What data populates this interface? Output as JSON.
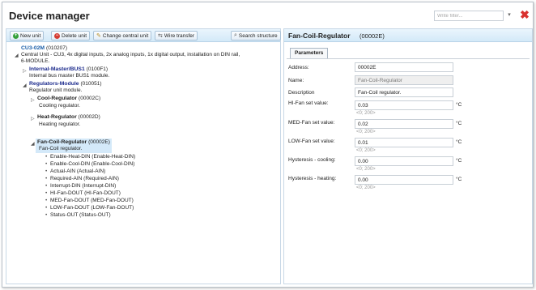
{
  "app": {
    "title": "Device manager",
    "filter_placeholder": "Write filter...",
    "close_label": "✖"
  },
  "toolbar": {
    "new_unit": "New unit",
    "delete_unit": "Delete unit",
    "change_central_unit": "Change central unit",
    "wire_transfer": "Wire transfer",
    "search_structure": "Search structure"
  },
  "tree": {
    "root": {
      "title": "CU3-02M",
      "code": "(010207)",
      "desc1": "Central Unit - CU3, 4x digital inputs, 2x analog inputs, 1x digital output, installation on DIN rail,",
      "desc2": "6-MODULE."
    },
    "internal_master": {
      "title": "Internal-Master/BUS1",
      "code": "(0100F1)",
      "desc": "Internal bus master BUS1 module."
    },
    "regulators": {
      "title": "Regulators-Module",
      "code": "(010051)",
      "desc": "Regulator unit module."
    },
    "cool": {
      "title": "Cool-Regulator",
      "code": "(00002C)",
      "desc": "Cooling regulator."
    },
    "heat": {
      "title": "Heat-Regulator",
      "code": "(00002D)",
      "desc": "Heating regulator."
    },
    "fancoil": {
      "title": "Fan-Coil-Regulator",
      "code": "(00002E)",
      "desc": "Fan-Coil regulator.",
      "children": [
        "Enable-Heat-DIN (Enable-Heat-DIN)",
        "Enable-Cool-DIN (Enable-Cool-DIN)",
        "Actual-AIN (Actual-AIN)",
        "Required-AIN (Required-AIN)",
        "Interrupt-DIN (Interrupt-DIN)",
        "HI-Fan-DOUT (HI-Fan-DOUT)",
        "MED-Fan-DOUT (MED-Fan-DOUT)",
        "LOW-Fan-DOUT (LOW-Fan-DOUT)",
        "Status-OUT (Status-OUT)"
      ]
    }
  },
  "detail": {
    "title": "Fan-Coil-Regulator",
    "code": "(00002E)",
    "tab": "Parameters",
    "address_label": "Address:",
    "address_value": "00002E",
    "name_label": "Name:",
    "name_value": "Fan-Coil-Regulator",
    "description_label": "Description",
    "description_value": "Fan-Coil regulator.",
    "params": [
      {
        "label": "HI-Fan set value:",
        "value": "0.03",
        "unit": "°C",
        "range": "<0; 200>"
      },
      {
        "label": "MED-Fan set value:",
        "value": "0.02",
        "unit": "°C",
        "range": "<0; 200>"
      },
      {
        "label": "LOW-Fan set value:",
        "value": "0.01",
        "unit": "°C",
        "range": "<0; 200>"
      },
      {
        "label": "Hysteresis - cooling:",
        "value": "0.00",
        "unit": "°C",
        "range": "<0; 200>"
      },
      {
        "label": "Hysteresis - heating:",
        "value": "0.00",
        "unit": "°C",
        "range": "<0; 200>"
      }
    ]
  }
}
